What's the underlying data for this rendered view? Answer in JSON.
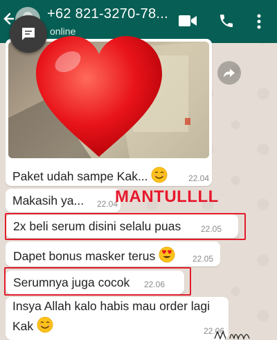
{
  "header": {
    "contact_name": "+62 821-3270-78...",
    "status": "online"
  },
  "overlay": {
    "mantul_text": "MANTULLLL"
  },
  "messages": [
    {
      "text": "Paket udah sampe Kak...",
      "time": "22.04",
      "emoji": "smiling-face"
    },
    {
      "text": "Makasih ya...",
      "time": "22.04"
    },
    {
      "text": "2x beli serum disini selalu puas",
      "time": "22.05",
      "highlighted": true
    },
    {
      "text": "Dapet bonus masker terus",
      "time": "22.05",
      "emoji": "heart-eyes-face"
    },
    {
      "text": "Serumnya juga cocok",
      "time": "22.06",
      "highlighted": true
    },
    {
      "text_line1": "Insya Allah kalo habis mau order lagi",
      "text_line2": "Kak",
      "time": "22.06",
      "emoji": "smiling-face"
    }
  ],
  "colors": {
    "header": "#075e54",
    "chat_background": "#e5ddd5",
    "bubble": "#ffffff",
    "highlight": "#e21b2a"
  },
  "icons": [
    "back-arrow-icon",
    "video-call-icon",
    "phone-icon",
    "more-options-icon",
    "chat-bubble-icon",
    "forward-icon",
    "heart-sticker"
  ]
}
